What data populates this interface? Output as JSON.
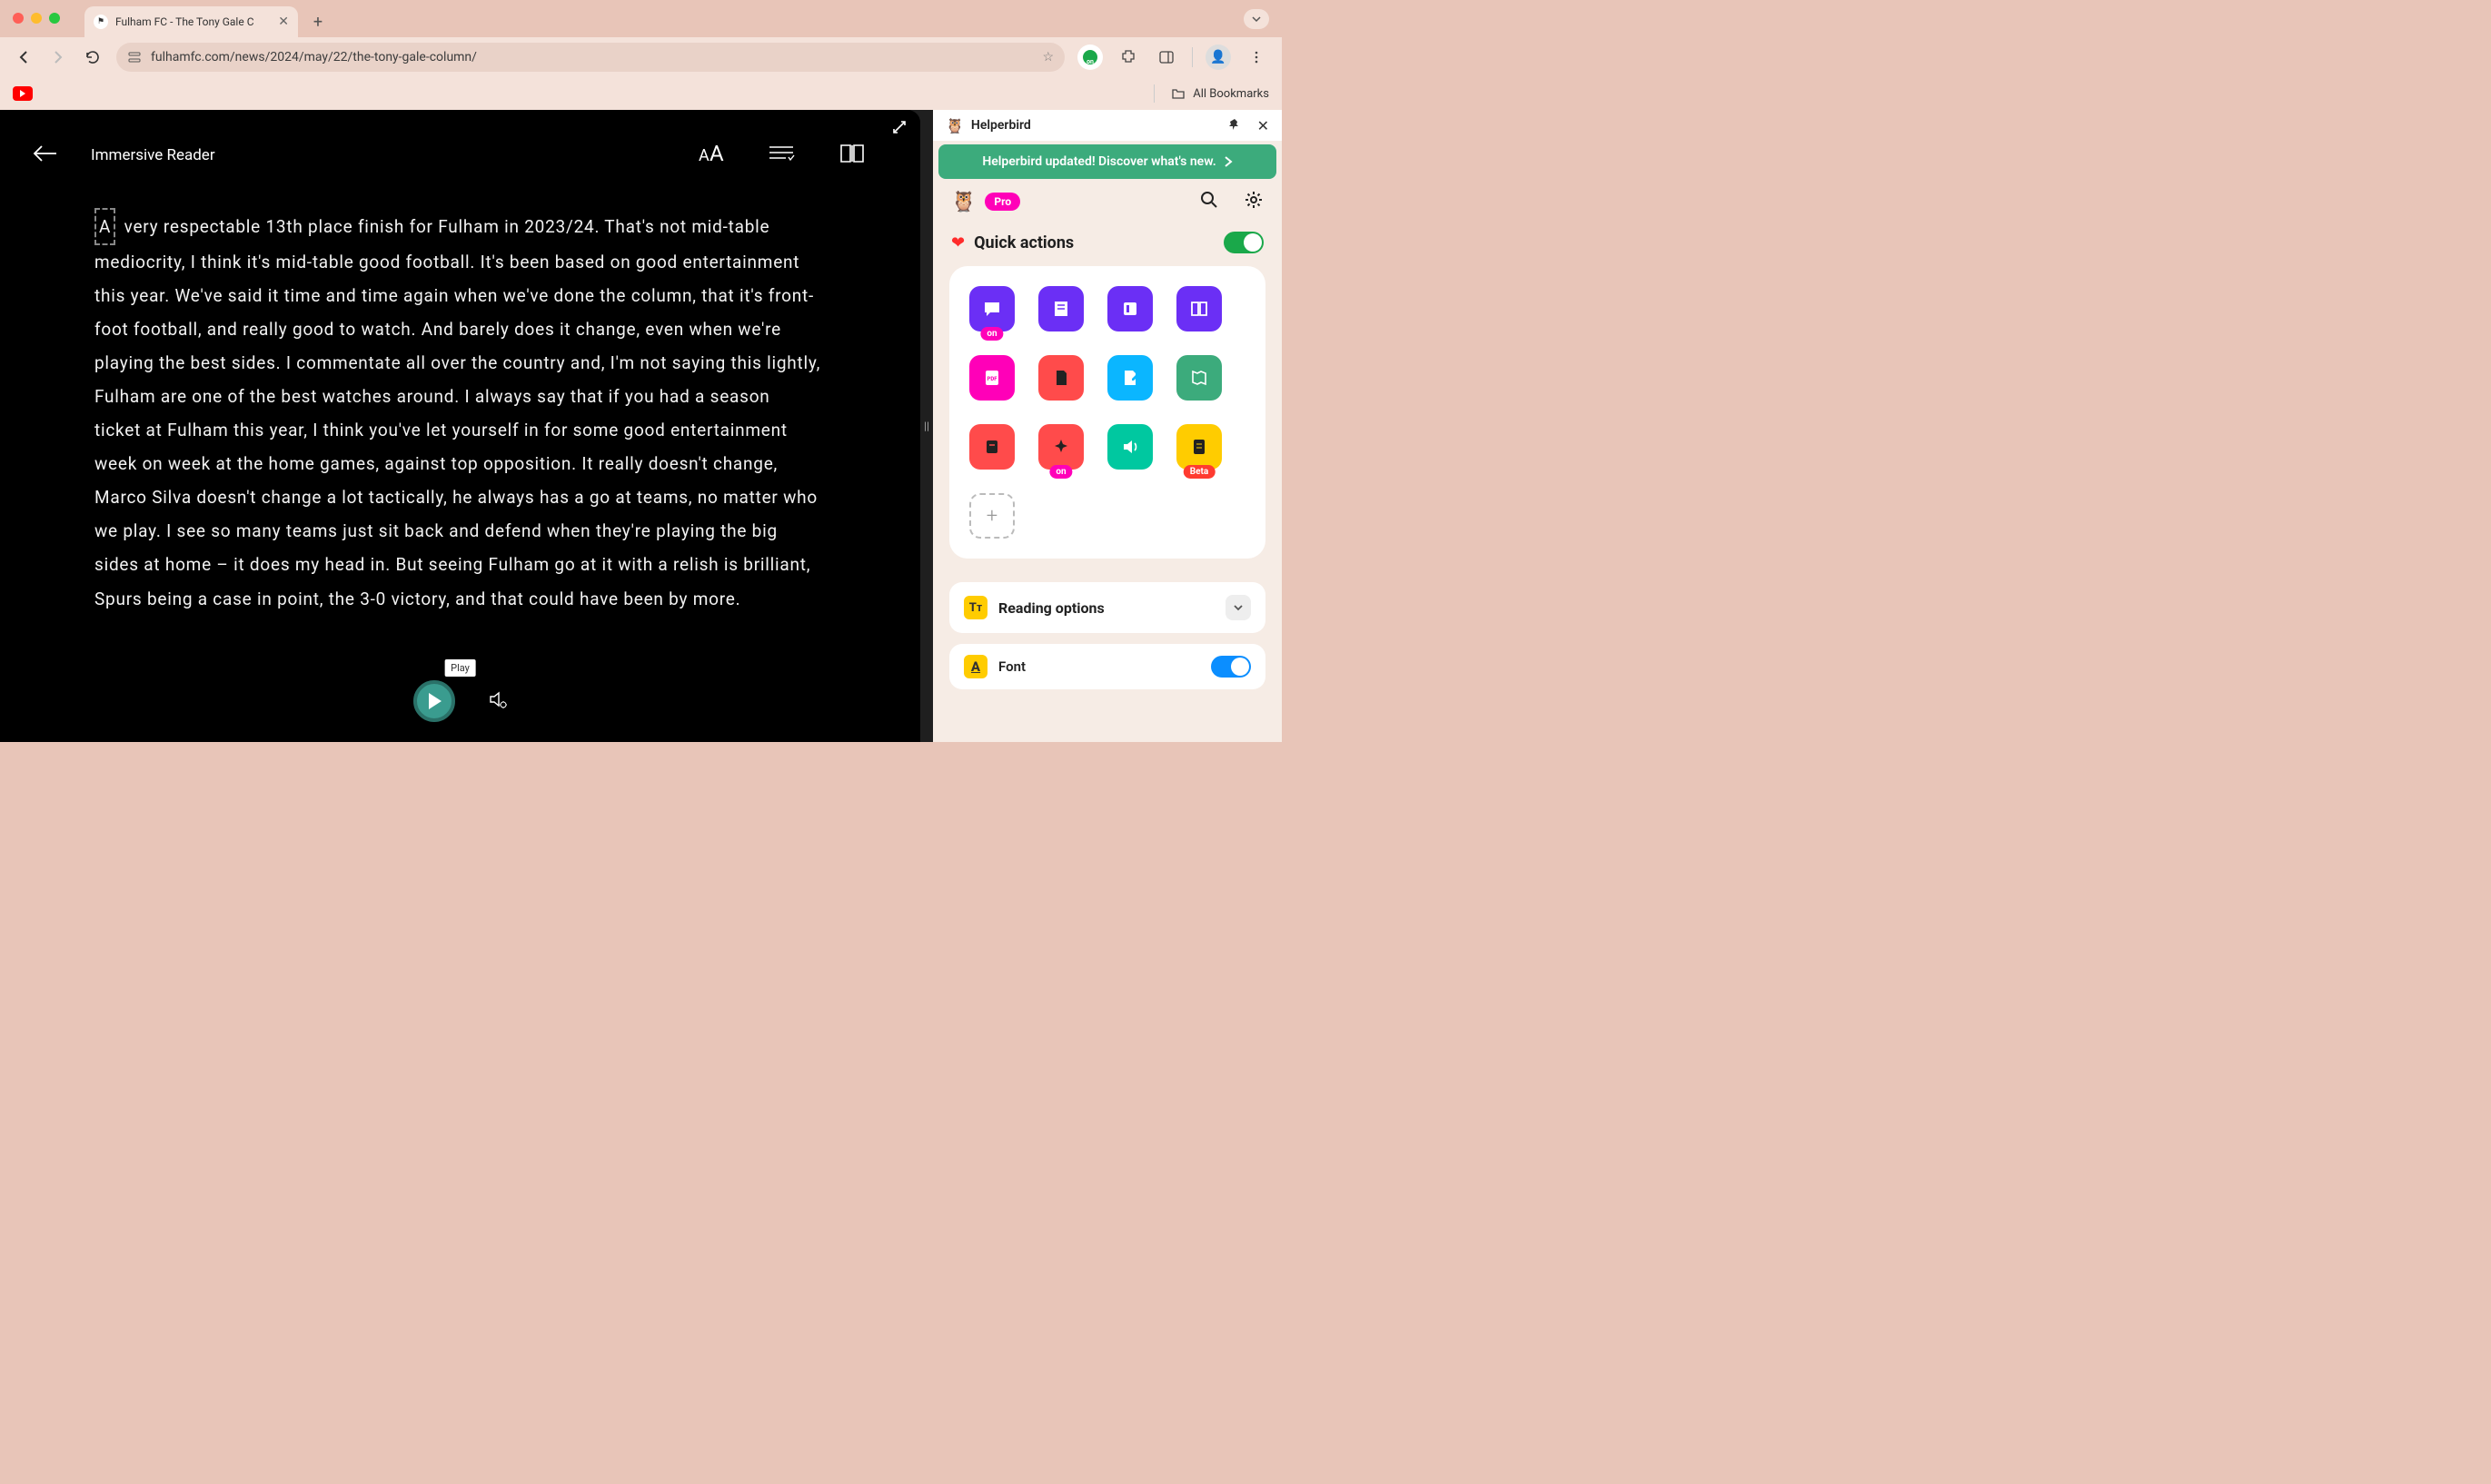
{
  "browser": {
    "tab_title": "Fulham FC - The Tony Gale C",
    "url": "fulhamfc.com/news/2024/may/22/the-tony-gale-column/",
    "all_bookmarks_label": "All Bookmarks"
  },
  "reader": {
    "title": "Immersive Reader",
    "tooltip_play": "Play",
    "article_text": "A very respectable 13th place finish for Fulham in 2023/24. That's not mid-table mediocrity, I think it's mid-table good football. It's been based on good entertainment this year. We've said it time and time again when we've done the column, that it's front-foot football, and really good to watch. And barely does it change, even when we're playing the best sides. I commentate all over the country and, I'm not saying this lightly, Fulham are one of the best watches around. I always say that if you had a season ticket at Fulham this year, I think you've let yourself in for some good entertainment week on week at the home games, against top opposition. It really doesn't change, Marco Silva doesn't change a lot tactically, he always has a go at teams, no matter who we play. I see so many teams just sit back and defend when they're playing the big sides at home – it does my head in. But seeing Fulham go at it with a relish is brilliant, Spurs being a case in point, the 3-0 victory, and that could have been by more."
  },
  "sidebar": {
    "extension_name": "Helperbird",
    "banner_text": "Helperbird updated! Discover what's new.",
    "pro_label": "Pro",
    "quick_actions_title": "Quick actions",
    "badge_on": "on",
    "badge_beta": "Beta",
    "reading_options_title": "Reading options",
    "font_label": "Font",
    "qa_items": [
      {
        "name": "chat-icon",
        "bg": "#6b2ff5",
        "badge": "on"
      },
      {
        "name": "notes-icon",
        "bg": "#6b2ff5"
      },
      {
        "name": "reader-icon",
        "bg": "#6b2ff5"
      },
      {
        "name": "book-icon",
        "bg": "#6b2ff5"
      },
      {
        "name": "pdf-icon",
        "bg": "#ff00b8"
      },
      {
        "name": "document-icon",
        "bg": "#ff4b4b"
      },
      {
        "name": "edit-icon",
        "bg": "#0bb6ff"
      },
      {
        "name": "map-icon",
        "bg": "#3cab7c"
      },
      {
        "name": "note-line-icon",
        "bg": "#ff4b4b"
      },
      {
        "name": "sparkle-icon",
        "bg": "#ff4b4b",
        "badge": "on"
      },
      {
        "name": "speaker-icon",
        "bg": "#00c8a0"
      },
      {
        "name": "calculator-icon",
        "bg": "#ffcc00",
        "badge": "Beta"
      }
    ]
  }
}
